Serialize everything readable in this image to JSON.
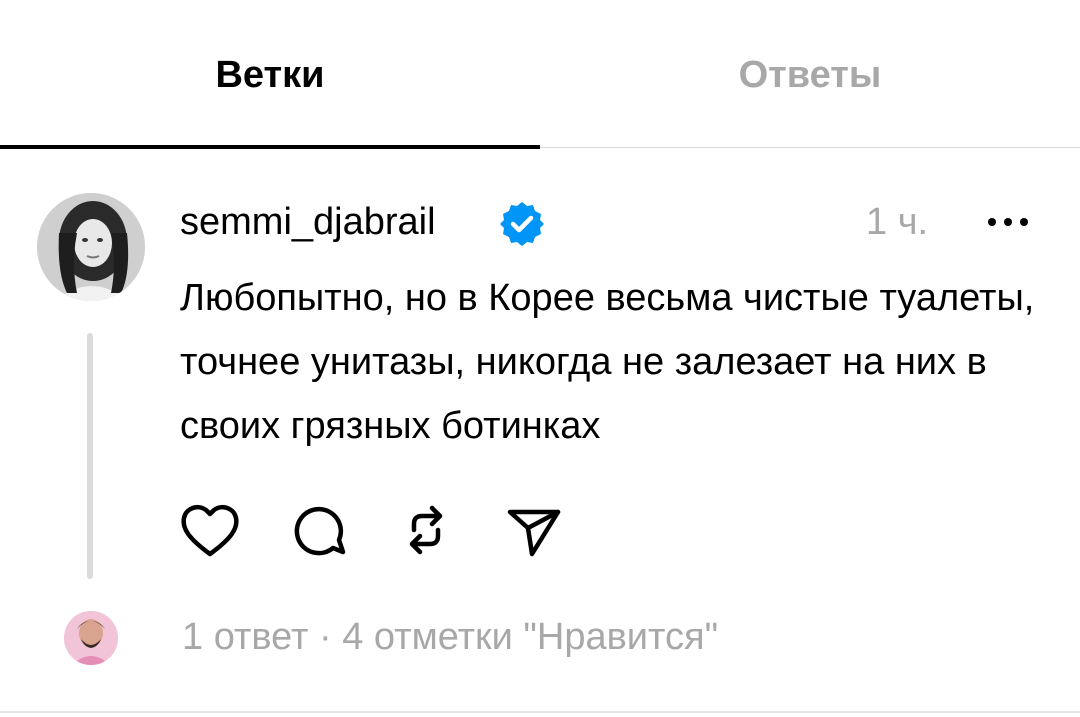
{
  "tabs": [
    {
      "label": "Ветки",
      "active": true
    },
    {
      "label": "Ответы",
      "active": false
    }
  ],
  "post": {
    "username": "semmi_djabrail",
    "verified": true,
    "time": "1 ч.",
    "text": "Любопытно, но в Корее весьма чистые туалеты, точнее унитазы, никогда не залезает на них в своих грязных ботинках",
    "actions": [
      "heart-icon",
      "comment-icon",
      "repost-icon",
      "share-icon"
    ]
  },
  "footer": {
    "replies": "1 ответ",
    "separator": "·",
    "likes": "4 отметки \"Нравится\""
  },
  "colors": {
    "verified": "#0095f6",
    "muted_text": "#a8a8a8",
    "divider": "#dbdbdb"
  }
}
